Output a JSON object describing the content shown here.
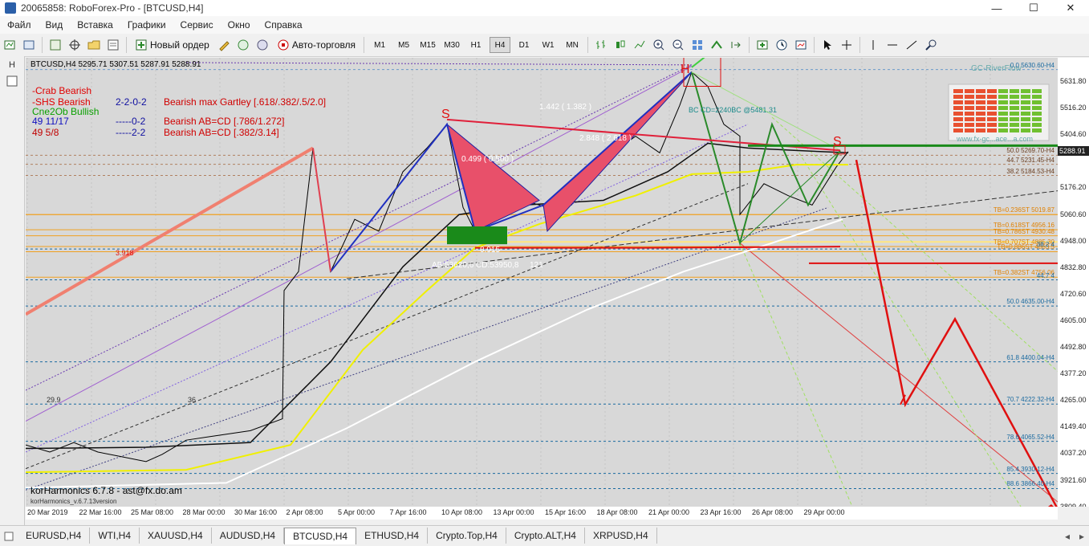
{
  "window": {
    "title": "20065858: RoboForex-Pro - [BTCUSD,H4]",
    "min_icon": "minimize-icon",
    "max_icon": "maximize-icon",
    "close_icon": "close-icon"
  },
  "menu": [
    "Файл",
    "Вид",
    "Вставка",
    "Графики",
    "Сервис",
    "Окно",
    "Справка"
  ],
  "toolbar": {
    "new_order": "Новый ордер",
    "auto_trading": "Авто-торговля",
    "timeframes": [
      "M1",
      "M5",
      "M15",
      "M30",
      "H1",
      "H4",
      "D1",
      "W1",
      "MN"
    ],
    "active_timeframe": "H4"
  },
  "chart": {
    "header": "BTCUSD,H4  5295.71 5307.51 5287.91 5288.91",
    "current_price": "5288.91",
    "bg_color": "#d8d8d8",
    "legend_rows": [
      {
        "col1": "-Crab Bearish",
        "col1_color": "#e00000",
        "col2": "",
        "col3": ""
      },
      {
        "col1": "-SHS Bearish",
        "col1_color": "#e00000",
        "col2": "2-2-0-2",
        "col3": "Bearish max Gartley [.618/.382/.5/2.0]"
      },
      {
        "col1": "Cne2Ob Bullish",
        "col1_color": "#0aa000",
        "col2": "",
        "col3": ""
      },
      {
        "col1": "49      11/17",
        "col1_color": "#1010c0",
        "col2": "-----0-2",
        "col3": "Bearish AB=CD [.786/1.272]"
      },
      {
        "col1": "49      5/8",
        "col1_color": "#c00000",
        "col2": "-----2-2",
        "col3": "Bearish AB=CD [.382/3.14]"
      }
    ],
    "labels": {
      "S1": "S",
      "H": "H",
      "S2": "S",
      "ratio1": "0.499 ( 0.500 )",
      "ratio2": "2.848 ( 2.618 )",
      "ratio3": "1.442 ( 1.382 )",
      "ratio4": "0.915",
      "cd": "AB:53620,6 CD:53950,8",
      "cd_count": "121",
      "bc": "BC CD=2240BC  @5481.31",
      "left_label": "3.918",
      "left_num1": "29.9",
      "left_num2": "36",
      "gc": "GC-RiverFlow",
      "gc_site": "www.fx-gc...ace...a.com"
    },
    "fib_labels": [
      {
        "text": "0.0   5630.60-H4",
        "color": "#1a6aa0",
        "price": 5630.6
      },
      {
        "text": "50.0   5269.70-H4",
        "color": "#6b3e20",
        "price": 5269.7
      },
      {
        "text": "44.7   5231.45-H4",
        "color": "#6b3e20",
        "price": 5231.45
      },
      {
        "text": "38.2   5184.53-H4",
        "color": "#6b3e20",
        "price": 5184.53
      },
      {
        "text": "TB=0.236ST   5019.87",
        "color": "#e08000",
        "price": 5019.87
      },
      {
        "text": "TB=0.618ST   4956.16",
        "color": "#e08000",
        "price": 4956.16
      },
      {
        "text": "TB=0.786ST   4930.48",
        "color": "#e08000",
        "price": 4930.48
      },
      {
        "text": "TB=0.707ST   4885.30",
        "color": "#e08000",
        "price": 4885.3
      },
      {
        "text": "TB=0.886ST   4863.5",
        "color": "#e08000",
        "price": 4863.5
      },
      {
        "text": "38.2   4",
        "color": "#1a6aa0",
        "price": 4875
      },
      {
        "text": "TB=0.382ST   4756.06",
        "color": "#e08000",
        "price": 4756.06
      },
      {
        "text": "44.7   4",
        "color": "#1a6aa0",
        "price": 4745
      },
      {
        "text": "50.0   4635.00-H4",
        "color": "#1a6aa0",
        "price": 4635
      },
      {
        "text": "61.8   4400.04-H4",
        "color": "#1a6aa0",
        "price": 4400.04
      },
      {
        "text": "70.7   4222.32-H4",
        "color": "#1a6aa0",
        "price": 4222.32
      },
      {
        "text": "78.6   4065.52-H4",
        "color": "#1a6aa0",
        "price": 4065.52
      },
      {
        "text": "85.4   3930.12-H4",
        "color": "#1a6aa0",
        "price": 3930.12
      },
      {
        "text": "88.6   3866.40-H4",
        "color": "#1a6aa0",
        "price": 3866.4
      }
    ],
    "price_ticks": [
      "5631.80",
      "5516.20",
      "5404.60",
      "5288.91",
      "5176.20",
      "5060.60",
      "4948.00",
      "4832.80",
      "4720.60",
      "4605.00",
      "4492.80",
      "4377.20",
      "4265.00",
      "4149.40",
      "4037.20",
      "3921.60",
      "3809.40"
    ],
    "time_ticks": [
      "20 Mar 2019",
      "22 Mar 16:00",
      "25 Mar 08:00",
      "28 Mar 00:00",
      "30 Mar 16:00",
      "2 Apr 08:00",
      "5 Apr 00:00",
      "7 Apr 16:00",
      "10 Apr 08:00",
      "13 Apr 00:00",
      "15 Apr 16:00",
      "18 Apr 08:00",
      "21 Apr 00:00",
      "23 Apr 16:00",
      "26 Apr 08:00",
      "29 Apr 00:00"
    ],
    "footer": "korHarmonics 6.7.8 - ast@fx.do.am",
    "footer_small": "korHarmonics_v.6.7.13version"
  },
  "tabs": [
    "EURUSD,H4",
    "WTI,H4",
    "XAUUSD,H4",
    "AUDUSD,H4",
    "BTCUSD,H4",
    "ETHUSD,H4",
    "Crypto.Top,H4",
    "Crypto.ALT,H4",
    "XRPUSD,H4"
  ],
  "active_tab": "BTCUSD,H4"
}
